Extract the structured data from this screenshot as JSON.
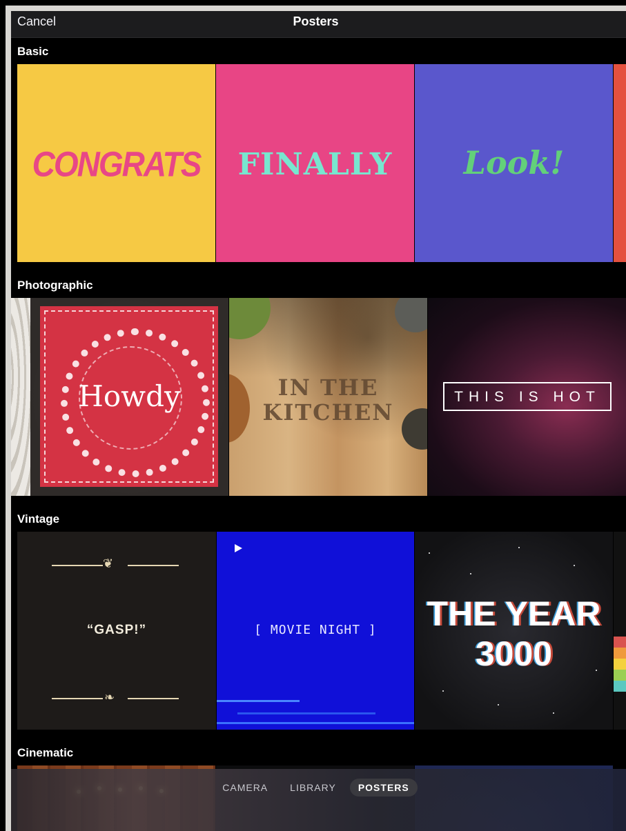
{
  "navbar": {
    "cancel_label": "Cancel",
    "title": "Posters"
  },
  "sections": {
    "basic": {
      "title": "Basic",
      "posters": [
        "CONGRATS",
        "FINALLY",
        "Look!"
      ]
    },
    "photographic": {
      "title": "Photographic",
      "posters": [
        "Howdy",
        "IN THE KITCHEN",
        "THIS IS HOT"
      ]
    },
    "vintage": {
      "title": "Vintage",
      "posters": [
        "“GASP!”",
        "[ MOVIE NIGHT ]",
        "THE YEAR 3000"
      ]
    },
    "cinematic": {
      "title": "Cinematic"
    }
  },
  "tabs": [
    "CAMERA",
    "LIBRARY",
    "POSTERS"
  ],
  "active_tab": "POSTERS",
  "colors": {
    "congrats_bg": "#f6c944",
    "finally_bg": "#e84585",
    "look_bg": "#5a57cc",
    "movie_bg": "#1010d8"
  }
}
